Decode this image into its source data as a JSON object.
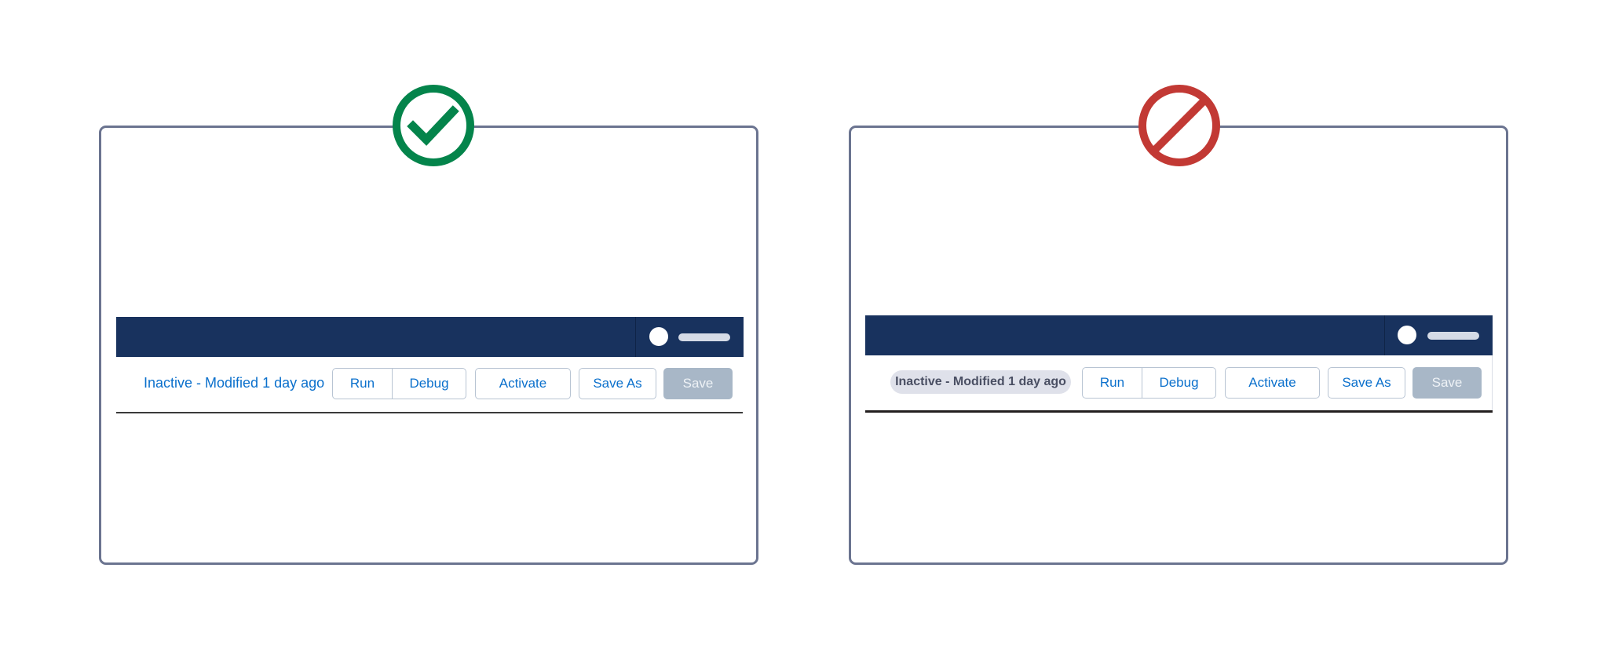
{
  "colors": {
    "navbar": "#18325e",
    "panel_border": "#6b7490",
    "link_blue": "#0b70cc",
    "success_green": "#04844b",
    "error_red": "#c23934",
    "badge_bg": "#dfe1ea",
    "save_disabled": "#a8b7c7"
  },
  "panels": [
    {
      "id": "do",
      "verdict_icon": "check-circle-icon",
      "verdict": "do",
      "status": {
        "style": "plain-text",
        "text": "Inactive - Modified 1 day ago"
      },
      "buttons": {
        "run": "Run",
        "debug": "Debug",
        "activate": "Activate",
        "save_as": "Save As",
        "save": "Save"
      },
      "save_disabled": true
    },
    {
      "id": "dont",
      "verdict_icon": "prohibited-icon",
      "verdict": "don't",
      "status": {
        "style": "badge",
        "text": "Inactive - Modified 1 day ago"
      },
      "buttons": {
        "run": "Run",
        "debug": "Debug",
        "activate": "Activate",
        "save_as": "Save As",
        "save": "Save"
      },
      "save_disabled": true
    }
  ]
}
